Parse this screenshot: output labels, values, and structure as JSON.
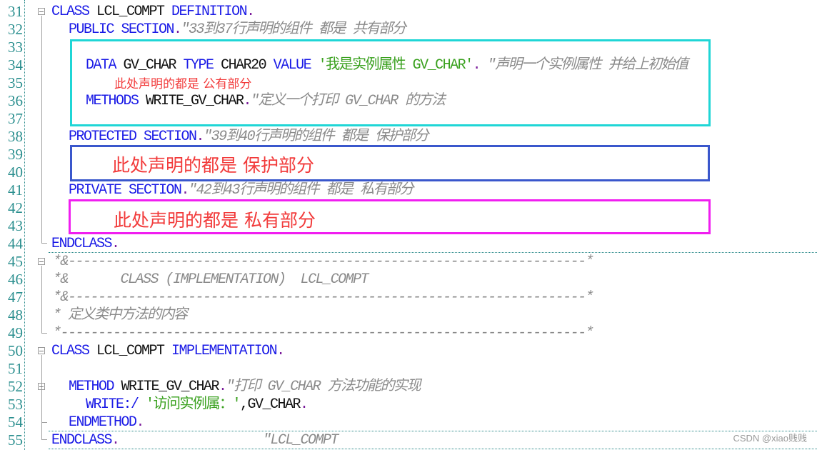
{
  "editor": {
    "line_numbers": [
      "31",
      "32",
      "33",
      "34",
      "35",
      "36",
      "37",
      "38",
      "39",
      "40",
      "41",
      "42",
      "43",
      "44",
      "45",
      "46",
      "47",
      "48",
      "49",
      "50",
      "51",
      "52",
      "53",
      "54",
      "55"
    ],
    "lines": {
      "l31": {
        "kw1": "CLASS",
        "id": " LCL_COMPT ",
        "kw2": "DEFINITION",
        "dot": "."
      },
      "l32": {
        "kw": "PUBLIC SECTION",
        "dot": ".",
        "cm": "\"33到37行声明的组件 都是 共有部分"
      },
      "l34": {
        "kw1": "DATA",
        "id1": " GV_CHAR ",
        "kw2": "TYPE",
        "id2": " CHAR20 ",
        "kw3": "VALUE",
        "str": " '我是实例属性 GV_CHAR'",
        "dot": ".",
        "cm": " \"声明一个实例属性 并给上初始值"
      },
      "l36": {
        "kw": "METHODS",
        "id": " WRITE_GV_CHAR",
        "dot": ".",
        "cm": "\"定义一个打印 GV_CHAR 的方法"
      },
      "l38": {
        "kw": "PROTECTED SECTION",
        "dot": ".",
        "cm": "\"39到40行声明的组件 都是 保护部分"
      },
      "l41": {
        "kw": "PRIVATE SECTION",
        "dot": ".",
        "cm": "\"42到43行声明的组件 都是 私有部分"
      },
      "l44": {
        "kw": "ENDCLASS",
        "dot": "."
      },
      "l45": {
        "cm": "*&---------------------------------------------------------------------*"
      },
      "l46": {
        "cm": "*&       CLASS (IMPLEMENTATION)  LCL_COMPT"
      },
      "l47": {
        "cm": "*&---------------------------------------------------------------------*"
      },
      "l48": {
        "cm": "* 定义类中方法的内容"
      },
      "l49": {
        "cm": "*----------------------------------------------------------------------*"
      },
      "l50": {
        "kw1": "CLASS",
        "id": " LCL_COMPT ",
        "kw2": "IMPLEMENTATION",
        "dot": "."
      },
      "l52": {
        "kw": "METHOD",
        "id": " WRITE_GV_CHAR",
        "dot": ".",
        "cm": "\"打印 GV_CHAR 方法功能的实现"
      },
      "l53": {
        "kw": "WRITE:/",
        "str": " '访问实例属：'",
        "id": ",GV_CHAR",
        "dot": "."
      },
      "l54": {
        "kw": "ENDMETHOD",
        "dot": "."
      },
      "l55": {
        "kw": "ENDCLASS",
        "dot": ".",
        "cm": "\"LCL_COMPT"
      }
    }
  },
  "annotations": {
    "public_note": "此处声明的都是 公有部分",
    "protected_note": "此处声明的都是 保护部分",
    "private_note": "此处声明的都是 私有部分",
    "colors": {
      "public_box": "#1fd6d6",
      "protected_box": "#3a57cc",
      "private_box": "#f01ef0",
      "note_text": "#f23b3b"
    }
  },
  "watermark": "CSDN @xiao贱贱"
}
